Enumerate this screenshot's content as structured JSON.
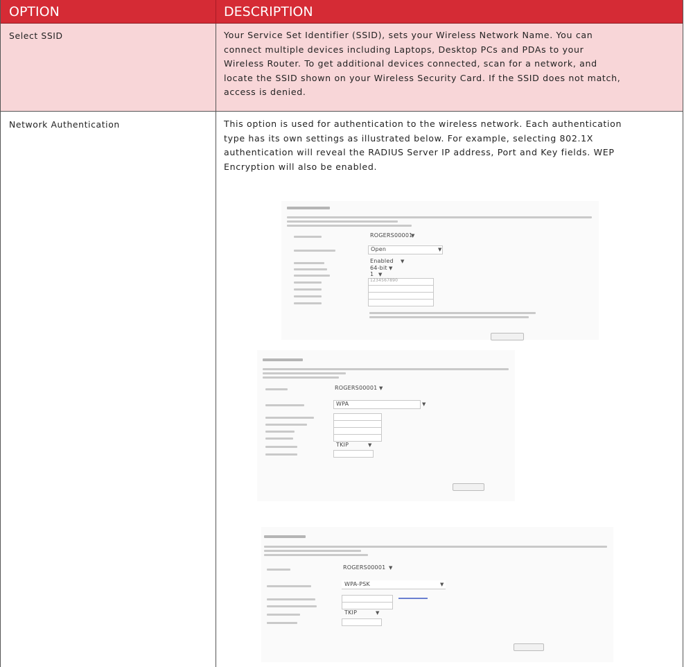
{
  "table": {
    "headers": {
      "option": "OPTION",
      "description": "DESCRIPTION"
    },
    "rows": [
      {
        "option": "Select SSID",
        "lines": [
          "Your Service Set Identifier (SSID), sets your Wireless Network Name. You can",
          "connect multiple devices including Laptops, Desktop PCs and PDAs to your",
          "Wireless Router. To get additional devices connected, scan for a network, and",
          "locate the SSID shown on your Wireless Security Card. If the SSID does not match,",
          "access is denied."
        ]
      },
      {
        "option": "Network Authentication",
        "lines": [
          "This option is used for authentication to the wireless network. Each authentication",
          "type has its own settings as illustrated below. For example, selecting 802.1X",
          "authentication will reveal the RADIUS Server IP address, Port and Key fields. WEP",
          "Encryption will also be enabled."
        ]
      }
    ]
  },
  "screenshots": [
    {
      "fields": [
        "ROGERS00001",
        "Open",
        "Enabled",
        "64-bit",
        "1",
        "1234567890"
      ]
    },
    {
      "fields": [
        "ROGERS00001",
        "WPA",
        "TKIP"
      ]
    },
    {
      "fields": [
        "ROGERS00001",
        "WPA-PSK",
        "TKIP"
      ]
    }
  ]
}
